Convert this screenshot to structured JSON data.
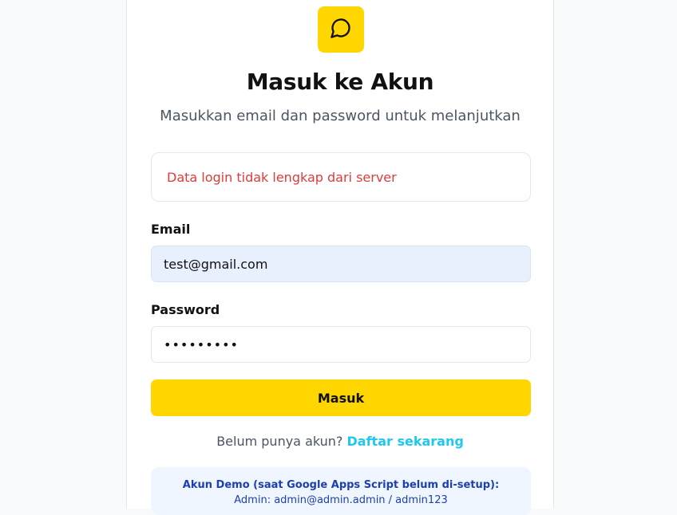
{
  "logo": {
    "icon": "chat-bubble-icon",
    "color": "#ffd600"
  },
  "header": {
    "title": "Masuk ke Akun",
    "subtitle": "Masukkan email dan password untuk melanjutkan"
  },
  "error": {
    "message": "Data login tidak lengkap dari server",
    "color": "#dc3c3c"
  },
  "form": {
    "email_label": "Email",
    "email_value": "test@gmail.com",
    "password_label": "Password",
    "password_value": "•••••••••",
    "submit_label": "Masuk"
  },
  "register": {
    "prompt": "Belum punya akun?",
    "link_label": "Daftar sekarang"
  },
  "demo": {
    "title": "Akun Demo (saat Google Apps Script belum di-setup):",
    "credentials": "Admin: admin@admin.admin / admin123"
  },
  "colors": {
    "accent": "#ffd600",
    "link": "#1ec8f0",
    "demo_text": "#1e40af"
  }
}
